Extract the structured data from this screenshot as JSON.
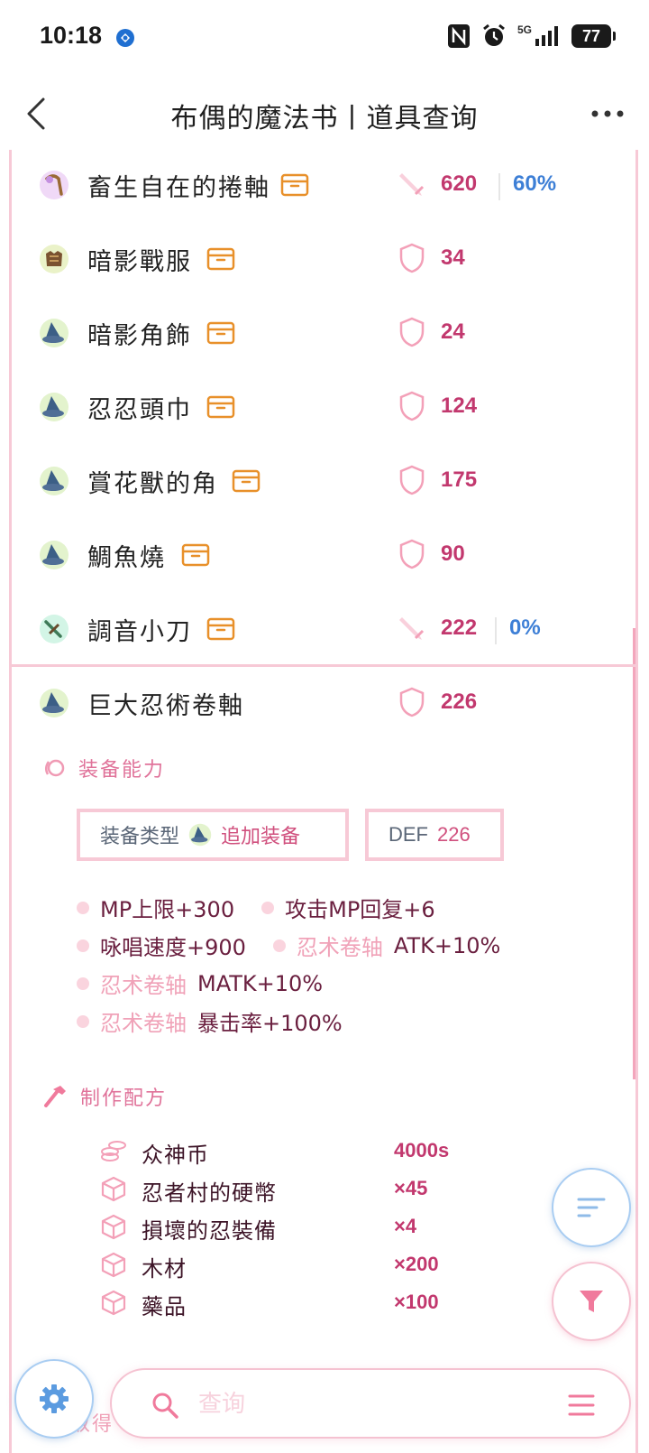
{
  "status_bar": {
    "time": "10:18",
    "network": "5G",
    "battery": "77"
  },
  "nav": {
    "title": "布偶的魔法书丨道具查询"
  },
  "items": [
    {
      "name": "畜生自在的捲軸",
      "stat": "620",
      "percent": "60%",
      "stat_type": "atk",
      "icon": "staff-icon"
    },
    {
      "name": "暗影戰服",
      "stat": "34",
      "stat_type": "def",
      "icon": "armor-icon"
    },
    {
      "name": "暗影角飾",
      "stat": "24",
      "stat_type": "def",
      "icon": "hat-icon"
    },
    {
      "name": "忍忍頭巾",
      "stat": "124",
      "stat_type": "def",
      "icon": "hat-icon"
    },
    {
      "name": "賞花獸的角",
      "stat": "175",
      "stat_type": "def",
      "icon": "hat-icon"
    },
    {
      "name": "鯛魚燒",
      "stat": "90",
      "stat_type": "def",
      "icon": "hat-icon"
    },
    {
      "name": "調音小刀",
      "stat": "222",
      "percent": "0%",
      "stat_type": "atk",
      "icon": "dagger-icon"
    }
  ],
  "selected": {
    "name": "巨大忍術卷軸",
    "stat": "226"
  },
  "ability": {
    "title": "装备能力",
    "type_label": "装备类型",
    "type_value": "追加装备",
    "def_label": "DEF",
    "def_value": "226",
    "lines": [
      [
        {
          "prefix": "",
          "text": "MP上限+300"
        },
        {
          "prefix": "",
          "text": "攻击MP回复+6"
        }
      ],
      [
        {
          "prefix": "",
          "text": "咏唱速度+900"
        },
        {
          "prefix": "忍术卷轴",
          "text": "ATK+10%"
        }
      ],
      [
        {
          "prefix": "忍术卷轴",
          "text": "MATK+10%"
        }
      ],
      [
        {
          "prefix": "忍术卷轴",
          "text": "暴击率+100%"
        }
      ]
    ]
  },
  "recipe": {
    "title": "制作配方",
    "rows": [
      {
        "name": "众神币",
        "qty": "4000s",
        "icon": "coins-icon"
      },
      {
        "name": "忍者村的硬幣",
        "qty": "×45",
        "icon": "cube-icon"
      },
      {
        "name": "損壞的忍裝備",
        "qty": "×4",
        "icon": "cube-icon"
      },
      {
        "name": "木材",
        "qty": "×200",
        "icon": "cube-icon"
      },
      {
        "name": "藥品",
        "qty": "×100",
        "icon": "cube-icon"
      }
    ]
  },
  "search": {
    "placeholder": "查询"
  },
  "peek": {
    "text": "取得"
  },
  "colors": {
    "accent_pink": "#c2386e",
    "light_pink": "#f7c9d6",
    "blue": "#3d7fd6",
    "box_orange": "#e8902a"
  }
}
